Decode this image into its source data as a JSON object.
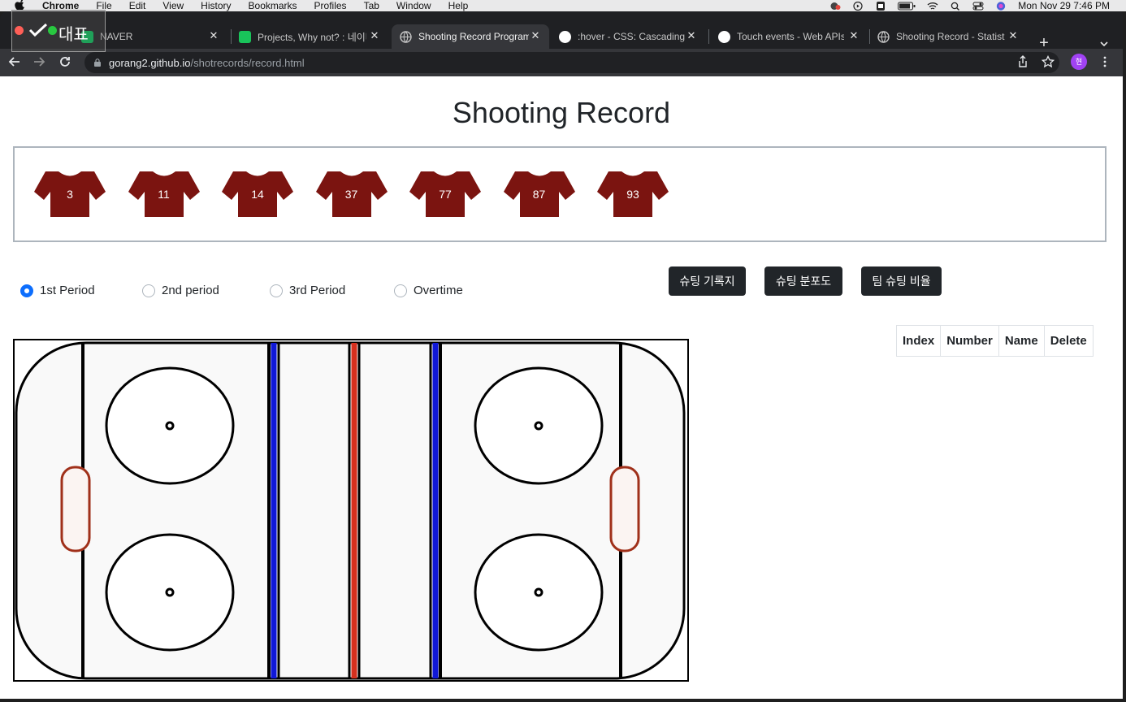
{
  "menubar": {
    "app": "Chrome",
    "items": [
      "File",
      "Edit",
      "View",
      "History",
      "Bookmarks",
      "Profiles",
      "Tab",
      "Window",
      "Help"
    ],
    "datetime": "Mon Nov 29  7:46 PM"
  },
  "overlay": {
    "label": "대표"
  },
  "tabs": [
    {
      "title": "NAVER",
      "icon": "naver-icon"
    },
    {
      "title": "Projects, Why not? : 네이버",
      "icon": "chat-icon"
    },
    {
      "title": "Shooting Record Program",
      "icon": "globe-icon"
    },
    {
      "title": ":hover - CSS: Cascading Sty",
      "icon": "mdn-icon"
    },
    {
      "title": "Touch events - Web APIs",
      "icon": "mdn-icon"
    },
    {
      "title": "Shooting Record - Statistics",
      "icon": "globe-icon"
    }
  ],
  "address": {
    "domain": "gorang2.github.io",
    "path": "/shotrecords/record.html"
  },
  "profile_initial": "현",
  "page": {
    "title": "Shooting Record",
    "players": [
      "3",
      "11",
      "14",
      "37",
      "77",
      "87",
      "93"
    ],
    "jersey_color": "#7b1410",
    "periods": [
      {
        "label": "1st Period",
        "checked": true
      },
      {
        "label": "2nd period",
        "checked": false
      },
      {
        "label": "3rd Period",
        "checked": false
      },
      {
        "label": "Overtime",
        "checked": false
      }
    ],
    "buttons": [
      "슈팅 기록지",
      "슈팅 분포도",
      "팀 슈팅 비율"
    ],
    "table_headers": [
      "Index",
      "Number",
      "Name",
      "Delete"
    ]
  }
}
